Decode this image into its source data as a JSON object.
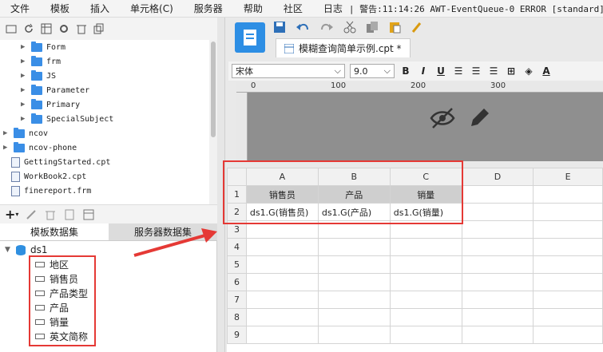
{
  "menu": [
    "文件",
    "模板",
    "插入",
    "单元格(C)",
    "服务器",
    "帮助",
    "社区",
    "日志"
  ],
  "log_text": "| 警告:11:14:26 AWT-EventQueue-0 ERROR [standard]",
  "tree": {
    "folders": [
      "Form",
      "frm",
      "JS",
      "Parameter",
      "Primary",
      "SpecialSubject"
    ],
    "root_folders": [
      "ncov",
      "ncov-phone"
    ],
    "files": [
      "GettingStarted.cpt",
      "WorkBook2.cpt",
      "finereport.frm"
    ]
  },
  "ds_tabs": {
    "template": "模板数据集",
    "server": "服务器数据集"
  },
  "dataset": {
    "name": "ds1",
    "fields": [
      "地区",
      "销售员",
      "产品类型",
      "产品",
      "销量",
      "英文简称"
    ]
  },
  "doc_tab": "模糊查询简单示例.cpt *",
  "format": {
    "font": "宋体",
    "size": "9.0"
  },
  "ruler_labels": [
    "0",
    "100",
    "200",
    "300"
  ],
  "sheet": {
    "columns": [
      "A",
      "B",
      "C",
      "D",
      "E"
    ],
    "rows": [
      "1",
      "2",
      "3",
      "4",
      "5",
      "6",
      "7",
      "8",
      "9"
    ],
    "row1": [
      "销售员",
      "产品",
      "销量"
    ],
    "row2": [
      "ds1.G(销售员)",
      "ds1.G(产品)",
      "ds1.G(销量)"
    ]
  },
  "colors": {
    "accent": "#2d8ee4",
    "highlight": "#e53935"
  }
}
